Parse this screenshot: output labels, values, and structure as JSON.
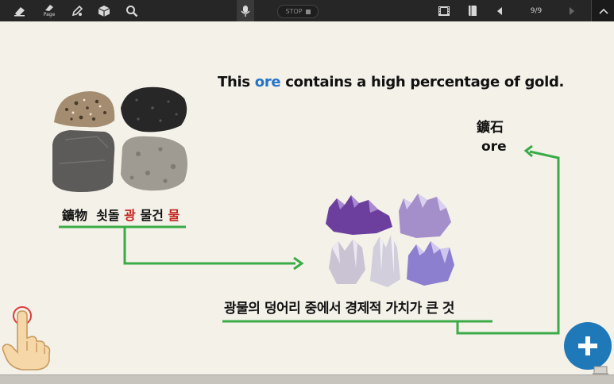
{
  "toolbar": {
    "tools": [
      "eraser-icon",
      "page-eraser-icon",
      "pen-settings-icon",
      "cube-icon",
      "search-icon"
    ],
    "page_eraser_label": "Page",
    "stop_label": "STOP",
    "page_indicator": "9/9"
  },
  "content": {
    "sentence_prefix": "This ",
    "sentence_highlight": "ore",
    "sentence_suffix": " contains a high percentage of gold.",
    "hanja_word": "鑛石",
    "english_word": "ore",
    "mineral_label_part1": "鑛物  쇳돌 ",
    "mineral_label_red1": "광",
    "mineral_label_part2": " 물건 ",
    "mineral_label_red2": "물",
    "definition": "광물의 덩어리 중에서 경제적 가치가 큰 것"
  },
  "colors": {
    "toolbar_bg": "#262626",
    "canvas_bg": "#f4f1e9",
    "highlight_blue": "#2574c7",
    "highlight_red": "#c3221c",
    "line_green": "#3aab47",
    "fab_blue": "#1f78b7"
  }
}
